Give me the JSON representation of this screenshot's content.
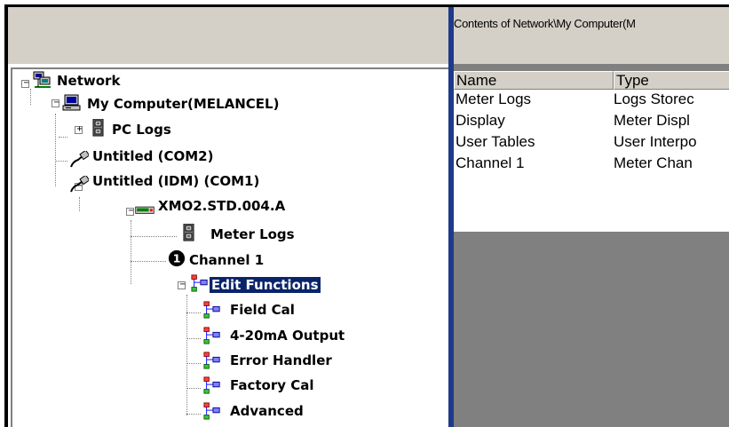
{
  "tree": {
    "collapse_glyph": "−",
    "expand_glyph": "+",
    "network": "Network",
    "my_computer": "My Computer(MELANCEL)",
    "pc_logs": "PC Logs",
    "com2": "Untitled (COM2)",
    "com1": "Untitled (IDM) (COM1)",
    "device": "XMO2.STD.004.A",
    "meter_logs": "Meter Logs",
    "channel_badge": "1",
    "channel_1": "Channel 1",
    "edit_functions": "Edit Functions",
    "field_cal": "Field Cal",
    "output": "4-20mA Output",
    "error_handler": "Error Handler",
    "factory_cal": "Factory Cal",
    "advanced": "Advanced",
    "selected_node": "Edit Functions"
  },
  "contents": {
    "path": "Contents of Network\\My Computer(M",
    "columns": [
      "Name",
      "Type"
    ],
    "rows": [
      {
        "name": "Meter Logs",
        "type": "Logs Storec"
      },
      {
        "name": "Display",
        "type": "Meter Displ"
      },
      {
        "name": "User Tables",
        "type": "User Interpo"
      },
      {
        "name": "Channel 1",
        "type": "Meter Chan"
      }
    ]
  },
  "colors": {
    "selection": "#0a246a",
    "splitter": "#1f3a8a",
    "panel_bg": "#d4d0c8",
    "empty_area": "#808080"
  },
  "icons": [
    "network-icon",
    "computer-icon",
    "cabinet-icon",
    "serial-cable-icon",
    "meter-device-icon",
    "channel-1-icon",
    "function-icon"
  ]
}
